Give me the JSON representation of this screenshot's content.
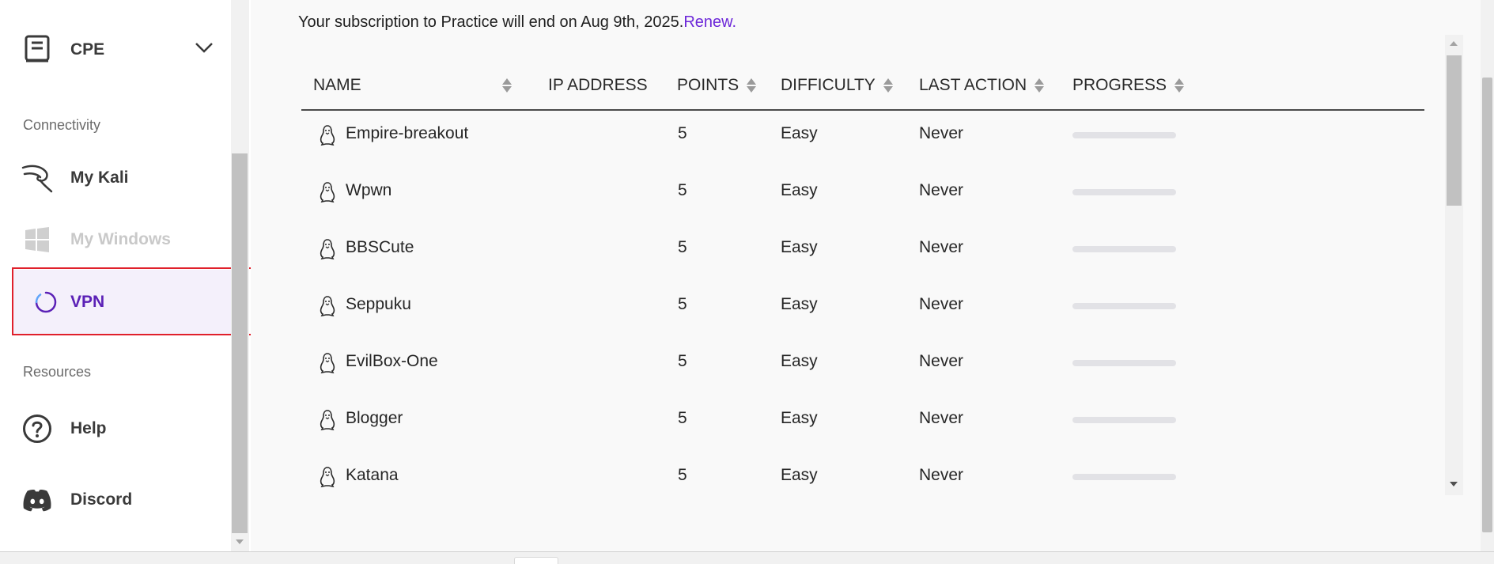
{
  "sidebar": {
    "cpe_label": "CPE",
    "connectivity_label": "Connectivity",
    "kali_label": "My Kali",
    "windows_label": "My Windows",
    "vpn_label": "VPN",
    "resources_label": "Resources",
    "help_label": "Help",
    "discord_label": "Discord"
  },
  "notice": {
    "text": "Your subscription to Practice will end on Aug 9th, 2025.",
    "link": "Renew."
  },
  "table": {
    "headers": {
      "name": "NAME",
      "ip": "IP ADDRESS",
      "points": "POINTS",
      "difficulty": "DIFFICULTY",
      "last_action": "LAST ACTION",
      "progress": "PROGRESS"
    },
    "rows": [
      {
        "name": "Empire-breakout",
        "ip": "",
        "points": "5",
        "difficulty": "Easy",
        "last_action": "Never",
        "progress": 0
      },
      {
        "name": "Wpwn",
        "ip": "",
        "points": "5",
        "difficulty": "Easy",
        "last_action": "Never",
        "progress": 0
      },
      {
        "name": "BBSCute",
        "ip": "",
        "points": "5",
        "difficulty": "Easy",
        "last_action": "Never",
        "progress": 0
      },
      {
        "name": "Seppuku",
        "ip": "",
        "points": "5",
        "difficulty": "Easy",
        "last_action": "Never",
        "progress": 0
      },
      {
        "name": "EvilBox-One",
        "ip": "",
        "points": "5",
        "difficulty": "Easy",
        "last_action": "Never",
        "progress": 0
      },
      {
        "name": "Blogger",
        "ip": "",
        "points": "5",
        "difficulty": "Easy",
        "last_action": "Never",
        "progress": 0
      },
      {
        "name": "Katana",
        "ip": "",
        "points": "5",
        "difficulty": "Easy",
        "last_action": "Never",
        "progress": 0
      }
    ]
  },
  "colors": {
    "accent": "#6d28d9",
    "vpn_active_bg": "#f4f0fb",
    "highlight_border": "#e0202b"
  }
}
